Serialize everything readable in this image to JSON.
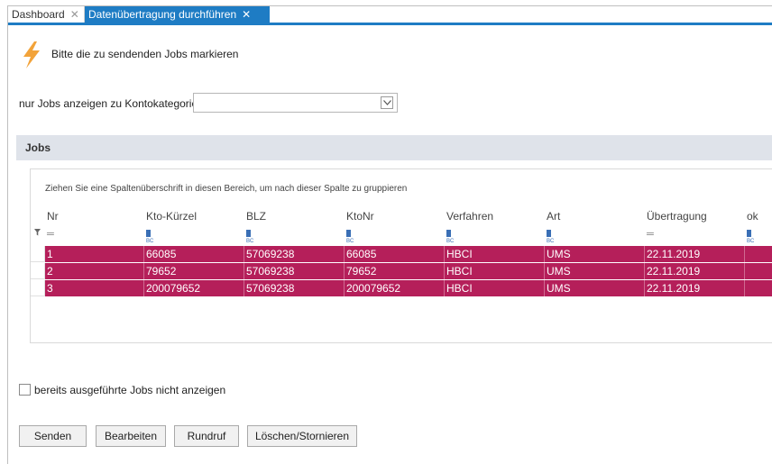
{
  "tabs": [
    {
      "label": "Dashboard",
      "close": "✕",
      "active": false
    },
    {
      "label": "Datenübertragung durchführen",
      "close": "✕",
      "active": true
    }
  ],
  "hint": "Bitte die zu sendenden Jobs markieren",
  "filter": {
    "label": "nur Jobs anzeigen zu Kontokategorie",
    "value": ""
  },
  "section_title": "Jobs",
  "group_hint": "Ziehen Sie eine Spaltenüberschrift in diesen Bereich, um nach dieser Spalte zu gruppieren",
  "columns": [
    "Nr",
    "Kto-Kürzel",
    "BLZ",
    "KtoNr",
    "Verfahren",
    "Art",
    "Übertragung",
    "ok"
  ],
  "rows": [
    [
      "1",
      "66085",
      "57069238",
      "66085",
      "HBCI",
      "UMS",
      "22.11.2019",
      ""
    ],
    [
      "2",
      "79652",
      "57069238",
      "79652",
      "HBCI",
      "UMS",
      "22.11.2019",
      ""
    ],
    [
      "3",
      "200079652",
      "57069238",
      "200079652",
      "HBCI",
      "UMS",
      "22.11.2019",
      ""
    ]
  ],
  "checkbox": {
    "label": "bereits ausgeführte Jobs nicht anzeigen",
    "checked": false
  },
  "buttons": {
    "send": "Senden",
    "edit": "Bearbeiten",
    "broadcast": "Rundruf",
    "delete": "Löschen/Stornieren"
  },
  "colors": {
    "accent": "#1e7cc4",
    "row_selected": "#b51f5a",
    "section_bg": "#dfe3ea"
  },
  "icons": {
    "hint": "lightning-icon",
    "filter_row": "funnel-icon",
    "text_filter": "abc-filter-icon",
    "equals_filter": "equals-filter-icon",
    "dropdown": "chevron-down-icon"
  }
}
